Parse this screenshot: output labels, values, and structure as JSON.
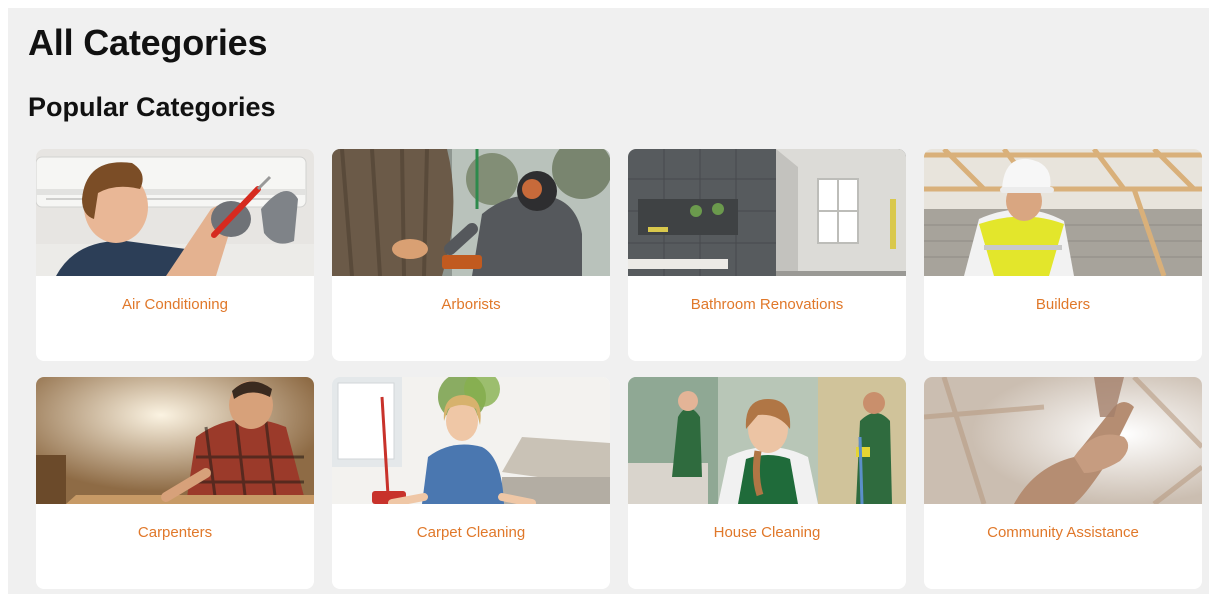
{
  "title": "All Categories",
  "section_title": "Popular Categories",
  "accent_color": "#e0782a",
  "categories": [
    {
      "label": "Air Conditioning",
      "image": "technician-repairing-air-conditioner"
    },
    {
      "label": "Arborists",
      "image": "arborist-cutting-tree"
    },
    {
      "label": "Bathroom Renovations",
      "image": "modern-tiled-bathroom"
    },
    {
      "label": "Builders",
      "image": "builder-in-hard-hat"
    },
    {
      "label": "Carpenters",
      "image": "carpenter-at-workbench"
    },
    {
      "label": "Carpet Cleaning",
      "image": "woman-cleaning-carpet"
    },
    {
      "label": "House Cleaning",
      "image": "cleaners-in-living-room"
    },
    {
      "label": "Community Assistance",
      "image": "helping-hands"
    }
  ]
}
